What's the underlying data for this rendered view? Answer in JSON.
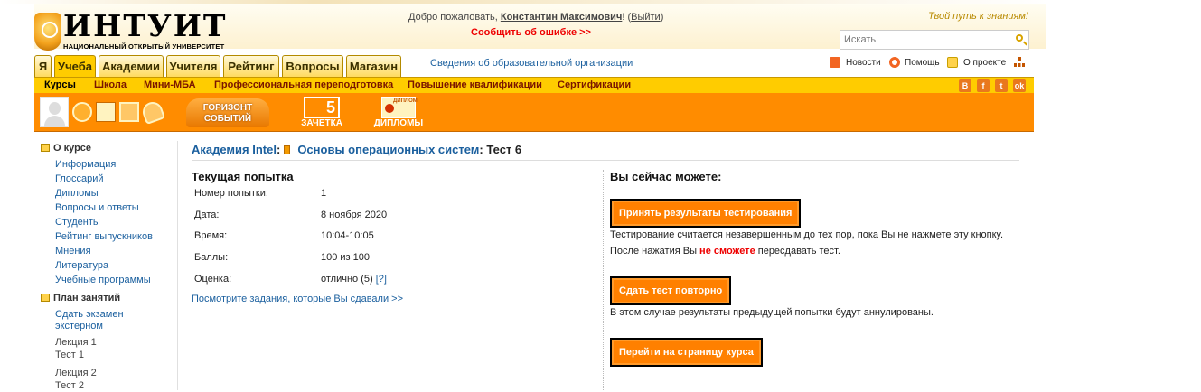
{
  "header": {
    "logo_word": "ИНТУИТ",
    "logo_sub": "НАЦИОНАЛЬНЫЙ ОТКРЫТЫЙ УНИВЕРСИТЕТ",
    "welcome_prefix": "Добро пожаловать, ",
    "user_name": "Константин Максимович",
    "welcome_mid": "! (",
    "logout_label": "Выйти",
    "welcome_suffix": ")",
    "report_error": "Сообщить об ошибке >>",
    "slogan": "Твой путь к знаниям!",
    "search_placeholder": "Искать"
  },
  "tabs": [
    {
      "label": "Я"
    },
    {
      "label": "Учеба",
      "active": true
    },
    {
      "label": "Академии"
    },
    {
      "label": "Учителя"
    },
    {
      "label": "Рейтинг"
    },
    {
      "label": "Вопросы"
    },
    {
      "label": "Магазин"
    }
  ],
  "org_info": "Сведения об образовательной организации",
  "toplinks": {
    "news": "Новости",
    "help": "Помощь",
    "about": "О проекте"
  },
  "subnav": [
    {
      "label": "Курсы",
      "current": true
    },
    {
      "label": "Школа"
    },
    {
      "label": "Мини-МБА"
    },
    {
      "label": "Профессиональная переподготовка"
    },
    {
      "label": "Повышение квалификации"
    },
    {
      "label": "Сертификации"
    }
  ],
  "social": [
    "В",
    "f",
    "t",
    "ok"
  ],
  "social_colors": [
    "#e9781d",
    "#e9781d",
    "#e9781d",
    "#e9781d"
  ],
  "orangebar": {
    "horizon_line1": "ГОРИЗОНТ",
    "horizon_line2": "СОБЫТИЙ",
    "zachetka_grade": "5",
    "zachetka": "ЗАЧЕТКА",
    "diplomy_tag": "ДИПЛОМ",
    "diplomy": "ДИПЛОМЫ"
  },
  "sidebar": {
    "about_head": "О курсе",
    "about_items": [
      "Информация",
      "Глоссарий",
      "Дипломы",
      "Вопросы и ответы",
      "Студенты",
      "Рейтинг выпускников",
      "Мнения",
      "Литература",
      "Учебные программы"
    ],
    "plan_head": "План занятий",
    "exam_line1": "Сдать экзамен",
    "exam_line2": "экстерном",
    "lecture1": "Лекция 1",
    "test1": "Тест 1",
    "lecture2": "Лекция 2",
    "test2": "Тест 2"
  },
  "crumbs": {
    "academy": "Академия Intel",
    "sep1": ":",
    "course": "Основы операционных систем",
    "sep2": ": ",
    "test": "Тест 6"
  },
  "attempt": {
    "title": "Текущая попытка",
    "rows": [
      {
        "label": "Номер попытки:",
        "value": "1"
      },
      {
        "label": "Дата:",
        "value": "8 ноября 2020"
      },
      {
        "label": "Время:",
        "value": "10:04-10:05"
      },
      {
        "label": "Баллы:",
        "value": "100 из 100"
      },
      {
        "label": "Оценка:",
        "value": "отлично (5) "
      }
    ],
    "help_link": "[?]",
    "view_tasks": "Посмотрите задания, которые Вы сдавали >>"
  },
  "actions": {
    "title": "Вы сейчас можете:",
    "accept_button": "Принять результаты тестирования",
    "note1": "Тестирование считается незавершенным до тех пор, пока Вы не нажмете эту кнопку.",
    "note2_prefix": "После нажатия Вы ",
    "note2_red": "не сможете",
    "note2_suffix": " пересдавать тест.",
    "retake_button": "Сдать тест повторно",
    "note3": "В этом случае результаты предыдущей попытки будут аннулированы.",
    "course_button": "Перейти на страницу курса"
  }
}
